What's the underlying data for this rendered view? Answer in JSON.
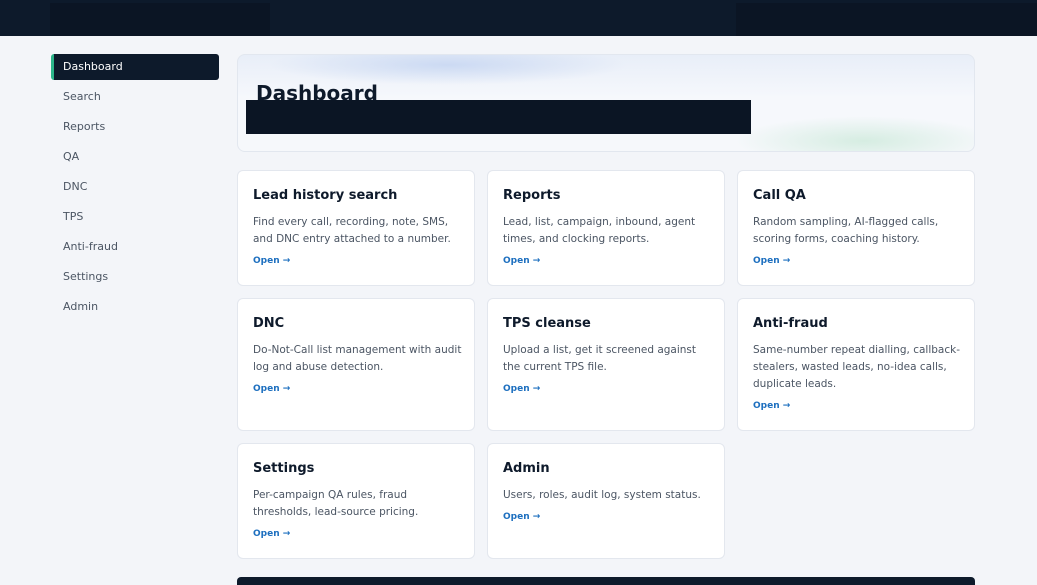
{
  "sidebar": {
    "items": [
      {
        "label": "Dashboard",
        "active": true
      },
      {
        "label": "Search"
      },
      {
        "label": "Reports"
      },
      {
        "label": "QA"
      },
      {
        "label": "DNC"
      },
      {
        "label": "TPS"
      },
      {
        "label": "Anti-fraud"
      },
      {
        "label": "Settings"
      },
      {
        "label": "Admin"
      }
    ]
  },
  "hero": {
    "title": "Dashboard"
  },
  "cards": [
    {
      "title": "Lead history search",
      "desc": "Find every call, recording, note, SMS, and DNC entry attached to a number.",
      "link": "Open →"
    },
    {
      "title": "Reports",
      "desc": "Lead, list, campaign, inbound, agent times, and clocking reports.",
      "link": "Open →"
    },
    {
      "title": "Call QA",
      "desc": "Random sampling, AI-flagged calls, scoring forms, coaching history.",
      "link": "Open →"
    },
    {
      "title": "DNC",
      "desc": "Do-Not-Call list management with audit log and abuse detection.",
      "link": "Open →"
    },
    {
      "title": "TPS cleanse",
      "desc": "Upload a list, get it screened against the current TPS file.",
      "link": "Open →"
    },
    {
      "title": "Anti-fraud",
      "desc": "Same-number repeat dialling, callback-stealers, wasted leads, no-idea calls, duplicate leads.",
      "link": "Open →"
    },
    {
      "title": "Settings",
      "desc": "Per-campaign QA rules, fraud thresholds, lead-source pricing.",
      "link": "Open →"
    },
    {
      "title": "Admin",
      "desc": "Users, roles, audit log, system status.",
      "link": "Open →"
    }
  ],
  "colors": {
    "accent": "#2bb58a",
    "navy": "#0d1a2b",
    "link": "#1d6fbf"
  }
}
